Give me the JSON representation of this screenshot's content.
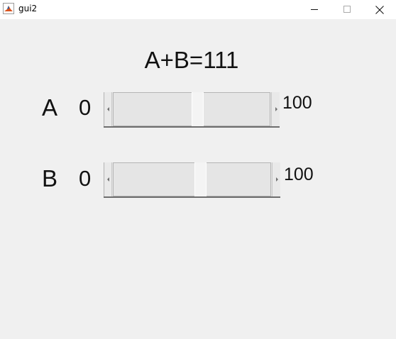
{
  "window": {
    "title": "gui2",
    "app_icon": "matlab-icon",
    "controls": [
      "minimize-icon",
      "maximize-icon",
      "close-icon"
    ]
  },
  "sum_display": "A+B=111",
  "sliders": [
    {
      "label": "A",
      "min_label": "0",
      "max_label": "100"
    },
    {
      "label": "B",
      "min_label": "0",
      "max_label": "100"
    }
  ],
  "colors": {
    "background": "#f0f0f0",
    "titlebar": "#ffffff",
    "text": "#111111"
  }
}
